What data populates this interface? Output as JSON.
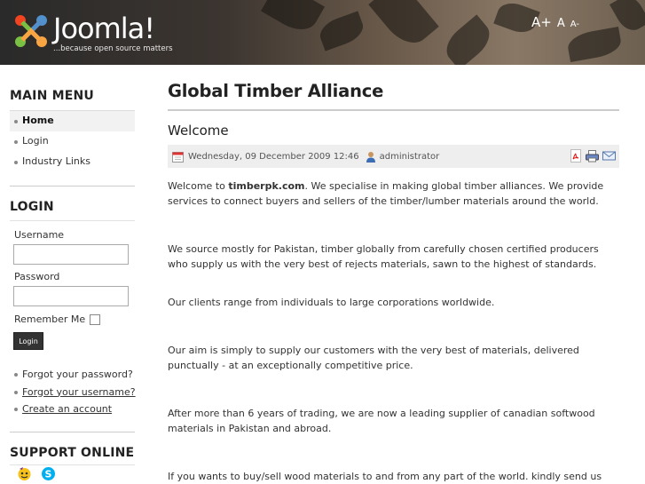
{
  "header": {
    "logo_text": "Joomla!",
    "logo_tagline": "...because open source matters",
    "font_controls": {
      "increase": "A+",
      "reset": "A",
      "decrease": "A-"
    }
  },
  "sidebar": {
    "main_menu": {
      "heading": "MAIN MENU",
      "items": [
        {
          "label": "Home",
          "active": true
        },
        {
          "label": "Login"
        },
        {
          "label": "Industry Links"
        }
      ]
    },
    "login": {
      "heading": "LOGIN",
      "username_label": "Username",
      "username_value": "",
      "password_label": "Password",
      "password_value": "",
      "remember_label": "Remember Me",
      "button_label": "Login",
      "links": [
        "Forgot your password?",
        "Forgot your username?",
        "Create an account"
      ]
    },
    "support": {
      "heading": "SUPPORT ONLINE",
      "icons": [
        "yahoo-messenger-icon",
        "skype-icon"
      ]
    }
  },
  "main": {
    "page_title": "Global Timber Alliance",
    "article_title": "Welcome",
    "meta": {
      "date": "Wednesday, 09 December 2009 12:46",
      "author": "administrator",
      "actions": [
        "pdf-icon",
        "print-icon",
        "email-icon"
      ]
    },
    "paragraphs": {
      "p1_prefix": "Welcome to ",
      "p1_site": "timberpk.com",
      "p1_suffix": ". We specialise in making global timber alliances. We provide services to connect buyers and sellers of the timber/lumber materials around the world.",
      "p2": "We source mostly for Pakistan, timber globally from carefully chosen certified producers who supply us with the very best of rejects materials, sawn to the highest of standards.",
      "p3": "Our clients range from individuals to large corporations worldwide.",
      "p4": "Our aim is simply to supply our customers with the very best of materials, delivered punctually - at an exceptionally competitive price.",
      "p5": "After more than 6 years of trading, we are now a leading supplier of canadian softwood materials in Pakistan and abroad.",
      "p6": "If you wants to buy/sell wood materials to and from any part of the world. kindly send us your proposals"
    }
  },
  "colors": {
    "header_dark": "#2a2a2a",
    "header_light": "#8a7866",
    "meta_bg": "#eeeeee",
    "button_bg": "#333333"
  }
}
